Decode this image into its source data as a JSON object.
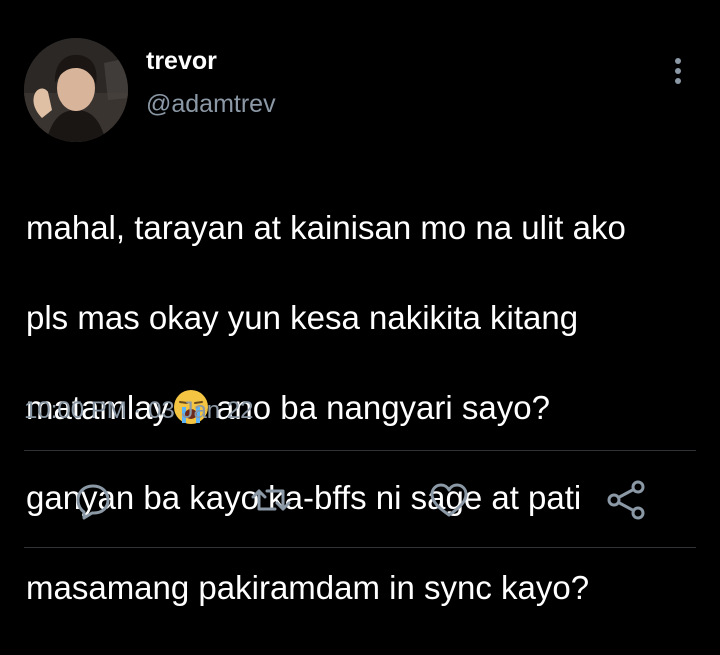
{
  "tweet": {
    "author": {
      "display_name": "trevor",
      "handle": "@adamtrev"
    },
    "text_lines": [
      "mahal, tarayan at kainisan mo na ulit ako",
      "pls mas okay yun kesa nakikita kitang",
      "matamlay",
      "ano ba nangyari sayo?",
      "ganyan ba kayo ka-bffs ni sage at pati",
      "masamang pakiramdam in sync kayo?"
    ],
    "emoji": "loudly-crying-face",
    "time": "10:00 PM",
    "separator": "·",
    "date": "03 Jan 22"
  },
  "actions": [
    "reply-icon",
    "retweet-icon",
    "like-icon",
    "share-icon"
  ],
  "colors": {
    "background": "#000000",
    "text": "#ffffff",
    "secondary": "#8b98a5",
    "divider": "#2f3336"
  }
}
